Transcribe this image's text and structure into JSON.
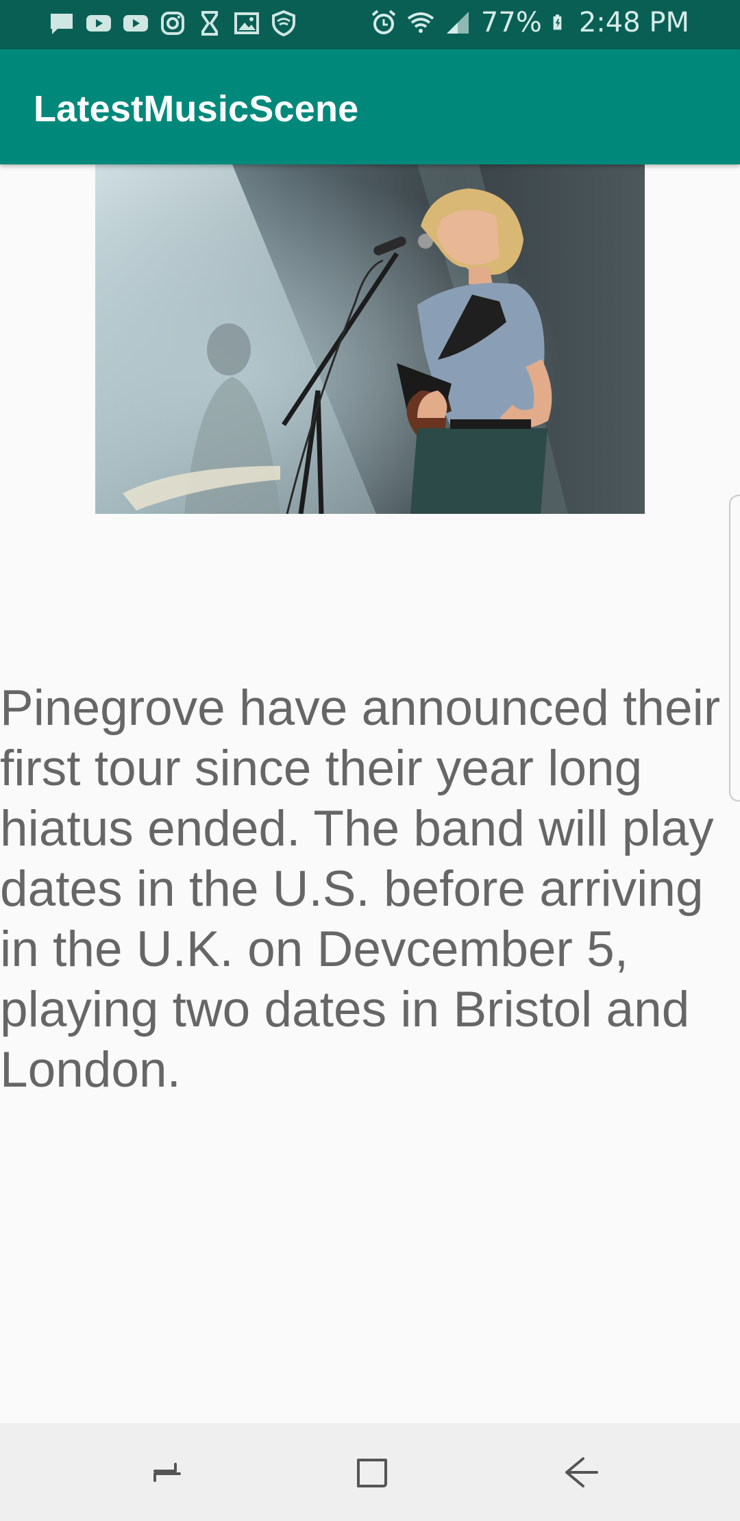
{
  "status_bar": {
    "left_icons": [
      "message-icon",
      "youtube-icon",
      "youtube-icon",
      "instagram-icon",
      "hourglass-icon",
      "gallery-icon",
      "vpn-shield-icon"
    ],
    "right_icons": [
      "alarm-icon",
      "wifi-icon",
      "signal-icon",
      "battery-icon"
    ],
    "battery": "77%",
    "time": "2:48 PM"
  },
  "app_bar": {
    "title": "LatestMusicScene",
    "color": "#00897b"
  },
  "article": {
    "image_icon": "concert-photo",
    "text": "Pinegrove have announced their first tour since their year long hiatus ended. The band will play dates in the U.S. before arriving in the U.K. on Devcember 5, playing two dates in Bristol and London."
  },
  "nav_bar": {
    "buttons": [
      "recents-icon",
      "home-icon",
      "back-icon"
    ]
  }
}
